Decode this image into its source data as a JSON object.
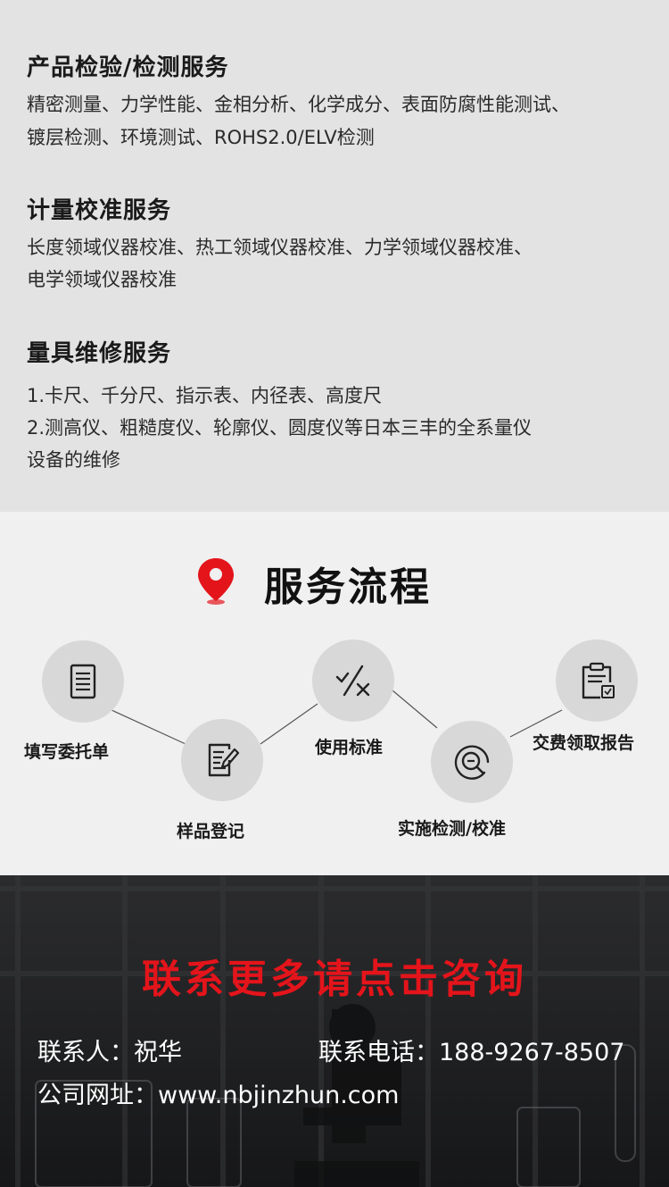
{
  "services": [
    {
      "title": "产品检验/检测服务",
      "lines": [
        "精密测量、力学性能、金相分析、化学成分、表面防腐性能测试、",
        "镀层检测、环境测试、ROHS2.0/ELV检测"
      ]
    },
    {
      "title": "计量校准服务",
      "lines": [
        "长度领域仪器校准、热工领域仪器校准、力学领域仪器校准、",
        "电学领域仪器校准"
      ]
    },
    {
      "title": "量具维修服务",
      "lines": [
        "1.卡尺、千分尺、指示表、内径表、高度尺",
        "2.测高仪、粗糙度仪、轮廓仪、圆度仪等日本三丰的全系量仪",
        "设备的维修"
      ]
    }
  ],
  "process": {
    "title": "服务流程",
    "pin_icon": "location-pin-icon",
    "accent_color": "#e4141b",
    "steps": [
      {
        "label": "填写委托单",
        "icon": "form-document-icon"
      },
      {
        "label": "样品登记",
        "icon": "edit-document-icon"
      },
      {
        "label": "使用标准",
        "icon": "percent-check-icon"
      },
      {
        "label": "实施检测/校准",
        "icon": "magnify-search-icon"
      },
      {
        "label": "交费领取报告",
        "icon": "clipboard-report-icon"
      }
    ]
  },
  "contact": {
    "title": "联系更多请点击咨询",
    "title_color": "#e4141b",
    "person": "联系人：祝华",
    "phone": "联系电话：188-9267-8507",
    "website": "公司网址：www.nbjinzhun.com"
  }
}
